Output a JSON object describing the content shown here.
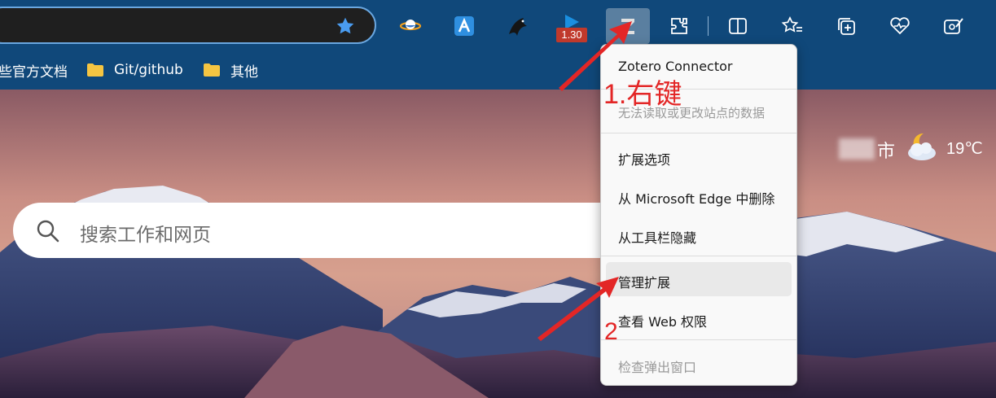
{
  "toolbar": {
    "extensions": [
      {
        "icon": "saturn-icon",
        "label": ""
      },
      {
        "icon": "quicker-icon",
        "label": ""
      },
      {
        "icon": "bird-icon",
        "label": ""
      },
      {
        "icon": "play-arrow-icon",
        "label": "1.30"
      },
      {
        "icon": "zotero-icon",
        "label": ""
      }
    ],
    "browser_buttons": [
      "puzzle-icon",
      "split-screen-icon",
      "favorites-icon",
      "collections-icon",
      "browser-essentials-icon",
      "feedback-icon"
    ]
  },
  "bookmarks": {
    "items": [
      {
        "label": "些官方文档"
      },
      {
        "label": "Git/github"
      },
      {
        "label": "其他"
      }
    ]
  },
  "search": {
    "placeholder": "搜索工作和网页"
  },
  "weather": {
    "city": "市",
    "temperature": "19℃"
  },
  "context_menu": {
    "header": "Zotero Connector",
    "items": [
      {
        "label": "无法读取或更改站点的数据",
        "enabled": false
      },
      {
        "label": "扩展选项",
        "enabled": true
      },
      {
        "label": "从 Microsoft Edge 中删除",
        "enabled": true
      },
      {
        "label": "从工具栏隐藏",
        "enabled": true
      },
      {
        "label": "管理扩展",
        "enabled": true,
        "highlighted": true
      },
      {
        "label": "查看 Web 权限",
        "enabled": true
      },
      {
        "label": "检查弹出窗口",
        "enabled": false
      }
    ]
  },
  "annotations": {
    "step1": "1.右键",
    "step2": "2"
  },
  "colors": {
    "toolbar_bg": "#10487a",
    "annotation_red": "#e32626",
    "star_blue": "#4a9cf0"
  }
}
